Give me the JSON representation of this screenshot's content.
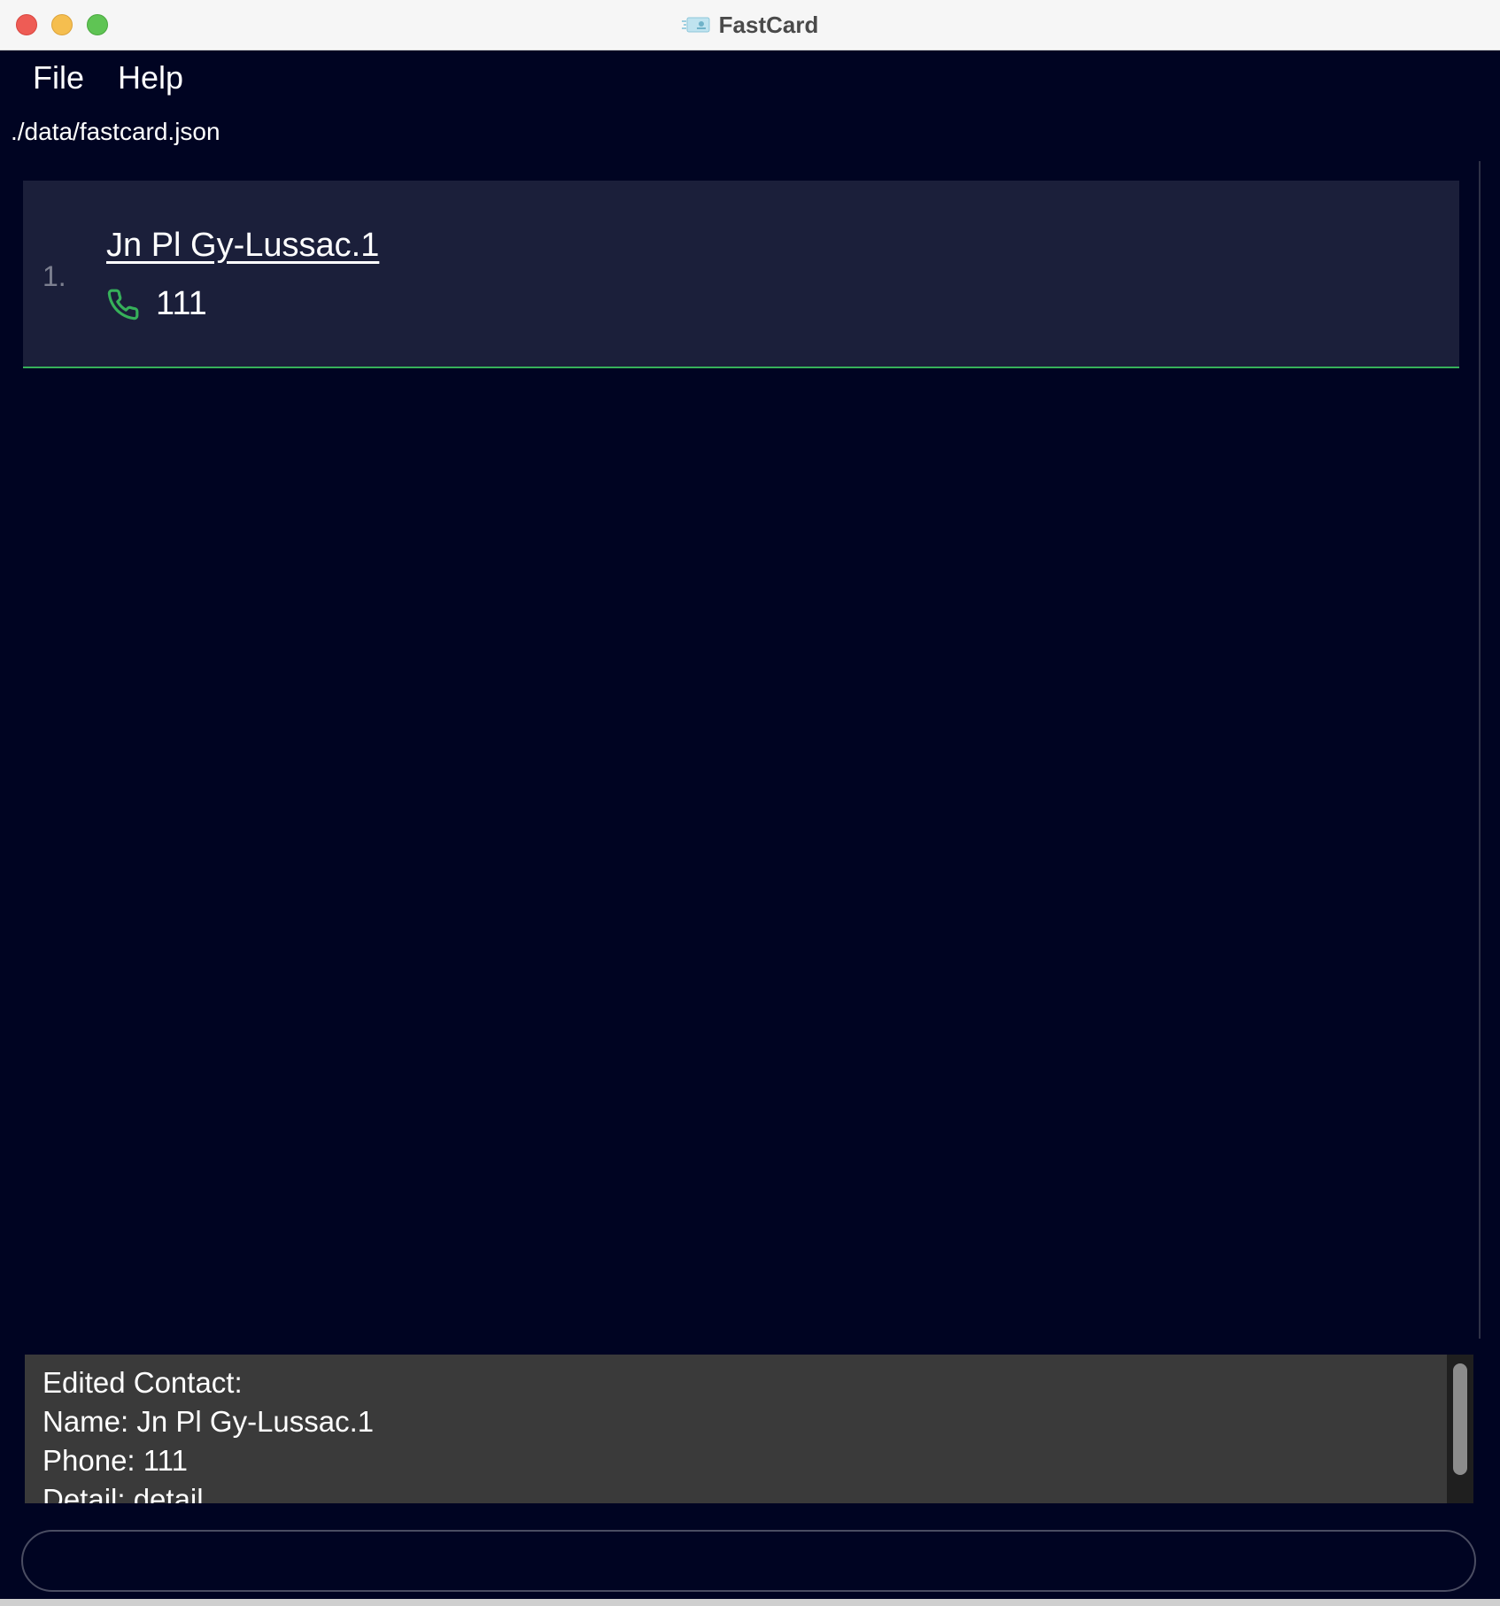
{
  "window": {
    "title": "FastCard",
    "app_icon": "card-icon",
    "controls": [
      "close",
      "minimize",
      "maximize"
    ]
  },
  "menu": {
    "items": [
      "File",
      "Help"
    ]
  },
  "status": {
    "file_path": "./data/fastcard.json"
  },
  "contacts": [
    {
      "index": "1.",
      "name": "Jn Pl Gy-Lussac.1",
      "phone": "111",
      "phone_icon": "phone-icon"
    }
  ],
  "result": {
    "lines": [
      "Edited Contact:",
      "Name: Jn Pl Gy-Lussac.1",
      "Phone: 111",
      "Detail: detail"
    ]
  },
  "command": {
    "value": "",
    "placeholder": ""
  },
  "colors": {
    "background": "#000422",
    "card": "#1b1f3a",
    "accent": "#36b05a",
    "result_bg": "#3a3a3a"
  }
}
